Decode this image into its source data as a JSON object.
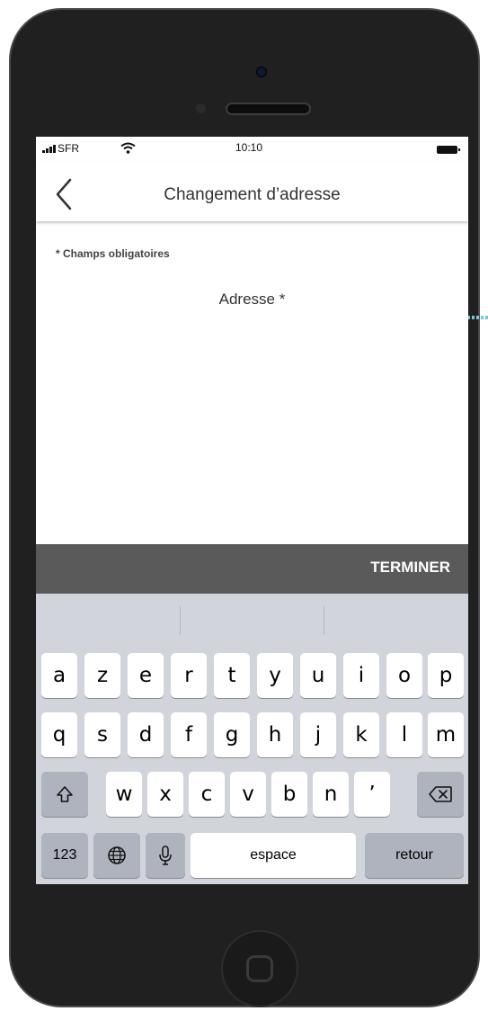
{
  "status_bar": {
    "carrier": "SFR",
    "time": "10:10"
  },
  "nav": {
    "title": "Changement d’adresse"
  },
  "form": {
    "required_note": "* Champs obligatoires",
    "address_label": "Adresse *"
  },
  "toolbar": {
    "done_label": "TERMINER"
  },
  "keyboard": {
    "row1": [
      "a",
      "z",
      "e",
      "r",
      "t",
      "y",
      "u",
      "i",
      "o",
      "p"
    ],
    "row2": [
      "q",
      "s",
      "d",
      "f",
      "g",
      "h",
      "j",
      "k",
      "l",
      "m"
    ],
    "row3": [
      "w",
      "x",
      "c",
      "v",
      "b",
      "n",
      "’"
    ],
    "numbers_label": "123",
    "space_label": "espace",
    "return_label": "retour"
  },
  "colors": {
    "toolbar_bg": "#5a5a5a",
    "keyboard_bg": "#d1d5db",
    "accent_dots": "#7ec6d6"
  }
}
